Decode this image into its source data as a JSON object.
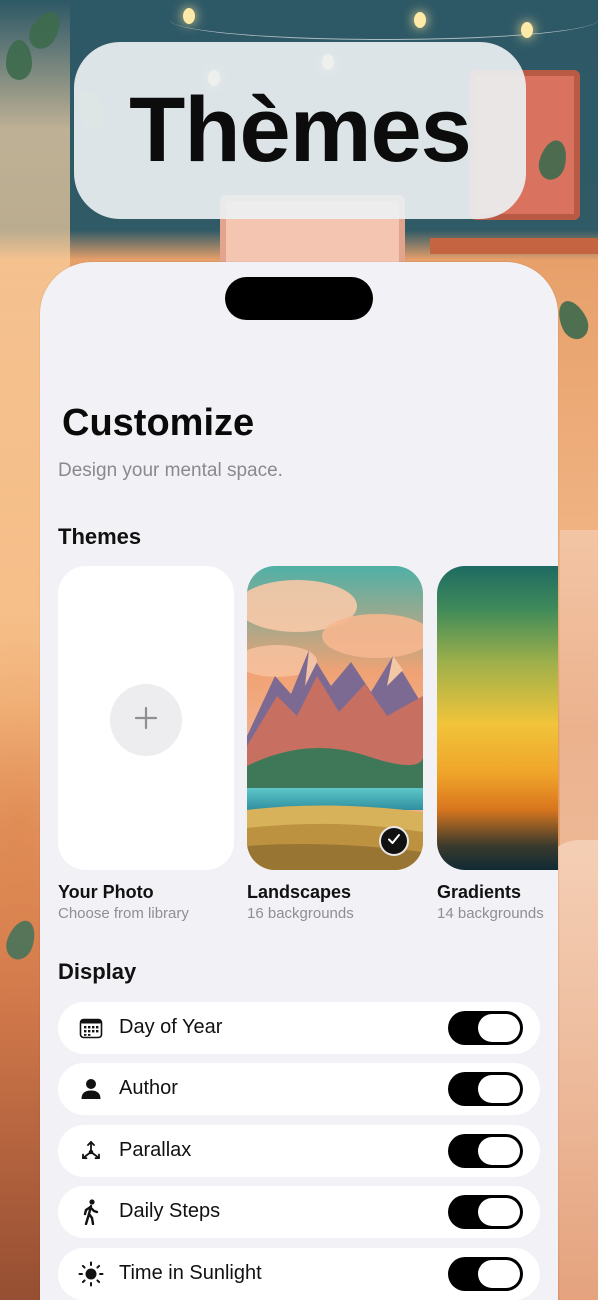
{
  "title_pill": {
    "title": "Thèmes"
  },
  "screen": {
    "title": "Customize",
    "subtitle": "Design your mental space."
  },
  "themes_section": {
    "label": "Themes",
    "cards": [
      {
        "name": "Your Photo",
        "description": "Choose from library",
        "icon": "plus-icon",
        "selected": false
      },
      {
        "name": "Landscapes",
        "description": "16 backgrounds",
        "icon": "checkmark-icon",
        "selected": true
      },
      {
        "name": "Gradients",
        "description": "14 backgrounds",
        "selected": false
      }
    ]
  },
  "display_section": {
    "label": "Display",
    "rows": [
      {
        "label": "Day of Year",
        "icon": "calendar-icon",
        "enabled": true
      },
      {
        "label": "Author",
        "icon": "person-icon",
        "enabled": true
      },
      {
        "label": "Parallax",
        "icon": "parallax-icon",
        "enabled": true
      },
      {
        "label": "Daily Steps",
        "icon": "walking-icon",
        "enabled": true
      },
      {
        "label": "Time in Sunlight",
        "icon": "sun-icon",
        "enabled": true
      }
    ]
  },
  "colors": {
    "toggle_on": "#000000",
    "sheet_background": "#f2f1f6",
    "secondary_text": "#8a8a8e"
  }
}
